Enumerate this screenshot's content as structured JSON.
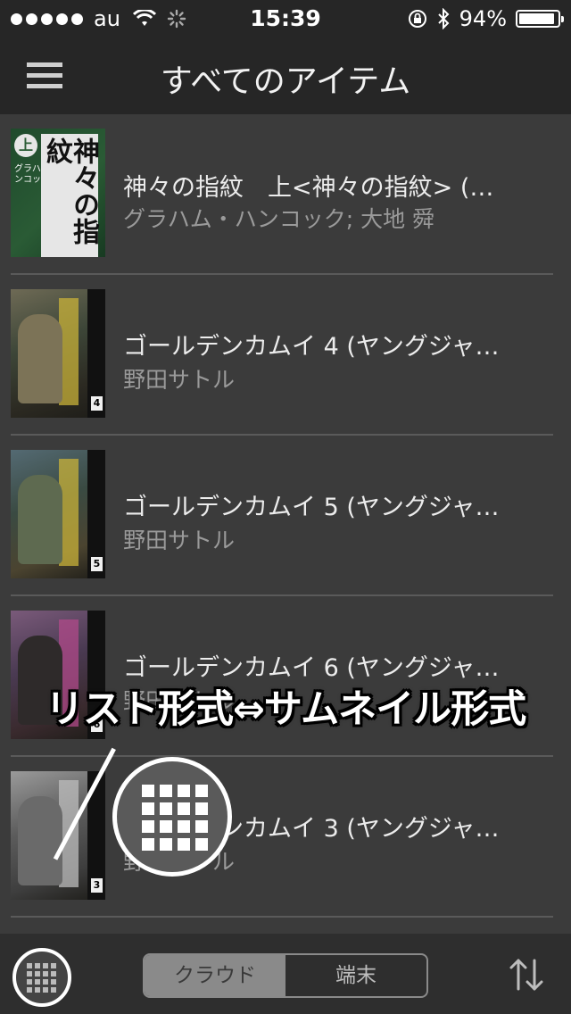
{
  "status_bar": {
    "carrier": "au",
    "time": "15:39",
    "battery_text": "94%",
    "battery_level": 0.94
  },
  "nav": {
    "title": "すべてのアイテム"
  },
  "list": [
    {
      "title": "神々の指紋　上<神々の指紋> (…",
      "author": "グラハム・ハンコック; 大地 舜",
      "cover": {
        "vertical_title": "神々の指紋",
        "badge": "上",
        "subtitle": "グラハム・ハンコック",
        "volume": ""
      }
    },
    {
      "title": "ゴールデンカムイ 4 (ヤングジャ…",
      "author": "野田サトル",
      "cover": {
        "volume": "4"
      }
    },
    {
      "title": "ゴールデンカムイ 5 (ヤングジャ…",
      "author": "野田サトル",
      "cover": {
        "volume": "5"
      }
    },
    {
      "title": "ゴールデンカムイ 6 (ヤングジャ…",
      "author": "野田サトル",
      "cover": {
        "volume": "6"
      }
    },
    {
      "title": "ゴールデンカムイ 3 (ヤングジャ…",
      "author": "野田サトル",
      "cover": {
        "volume": "3"
      }
    }
  ],
  "caption": "リスト形式⇔サムネイル形式",
  "toolbar": {
    "segment_cloud": "クラウド",
    "segment_device": "端末"
  }
}
